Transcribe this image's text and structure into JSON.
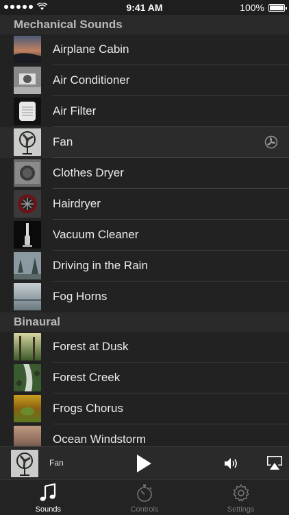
{
  "status_bar": {
    "time": "9:41 AM",
    "battery": "100%",
    "signal_icon": "signal-dots-icon",
    "wifi_icon": "wifi-icon",
    "battery_icon": "battery-icon"
  },
  "sections": [
    {
      "title": "Mechanical Sounds",
      "items": [
        {
          "label": "Airplane Cabin"
        },
        {
          "label": "Air Conditioner"
        },
        {
          "label": "Air Filter"
        },
        {
          "label": "Fan",
          "playing": true
        },
        {
          "label": "Clothes Dryer"
        },
        {
          "label": "Hairdryer"
        },
        {
          "label": "Vacuum Cleaner"
        },
        {
          "label": "Driving in the Rain"
        },
        {
          "label": "Fog Horns"
        }
      ]
    },
    {
      "title": "Binaural",
      "items": [
        {
          "label": "Forest at Dusk"
        },
        {
          "label": "Forest Creek"
        },
        {
          "label": "Frogs Chorus"
        },
        {
          "label": "Ocean Windstorm"
        }
      ]
    }
  ],
  "now_playing": {
    "title": "Fan",
    "play_icon": "play-icon",
    "volume_icon": "volume-icon",
    "airplay_icon": "airplay-icon"
  },
  "tabs": [
    {
      "label": "Sounds",
      "icon": "music-note-icon",
      "active": true
    },
    {
      "label": "Controls",
      "icon": "stopwatch-icon",
      "active": false
    },
    {
      "label": "Settings",
      "icon": "gear-icon",
      "active": false
    }
  ],
  "colors": {
    "background": "#1e1e1e",
    "row": "#222222",
    "section_header": "#2a2a2a",
    "active_tab": "#ffffff",
    "inactive_tab": "#777777"
  }
}
